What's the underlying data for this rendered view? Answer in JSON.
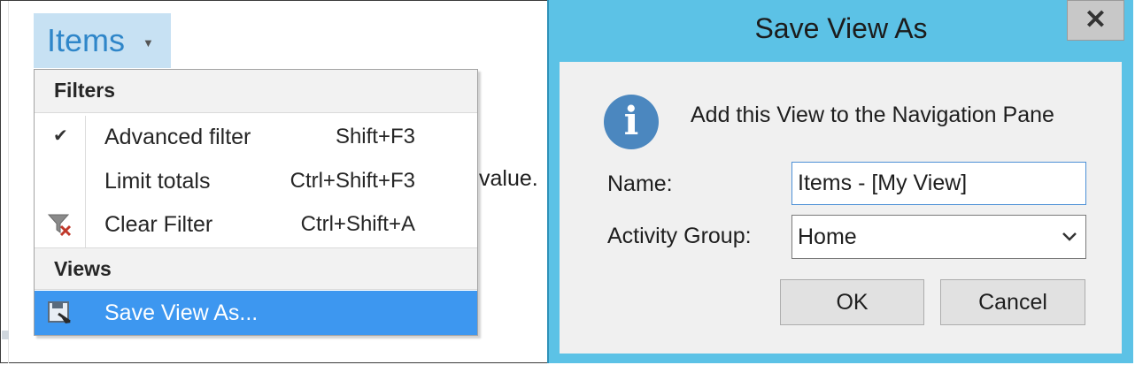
{
  "ribbon": {
    "items_button_label": "Items",
    "background_text": "value."
  },
  "menu": {
    "filters_header": "Filters",
    "items": [
      {
        "label": "Advanced filter",
        "shortcut": "Shift+F3",
        "icon": "check-icon",
        "checked": true
      },
      {
        "label": "Limit totals",
        "shortcut": "Ctrl+Shift+F3",
        "icon": null,
        "checked": false
      },
      {
        "label": "Clear Filter",
        "shortcut": "Ctrl+Shift+A",
        "icon": "clear-filter-icon",
        "checked": false
      }
    ],
    "views_header": "Views",
    "save_view_item": {
      "label": "Save View As...",
      "icon": "save-view-icon",
      "highlighted": true
    }
  },
  "dialog": {
    "title": "Save View As",
    "close_icon": "close-icon",
    "info_icon": "info-icon",
    "message": "Add this View to the Navigation Pane",
    "name_label": "Name:",
    "name_value": "Items - [My View]",
    "group_label": "Activity Group:",
    "group_value": "Home",
    "ok_label": "OK",
    "cancel_label": "Cancel"
  },
  "colors": {
    "dialog_frame": "#5cc2e6",
    "menu_highlight": "#3d97f0",
    "items_button_bg": "#c7e1f3",
    "items_button_text": "#2f86c9",
    "info_icon": "#4b87bf"
  }
}
